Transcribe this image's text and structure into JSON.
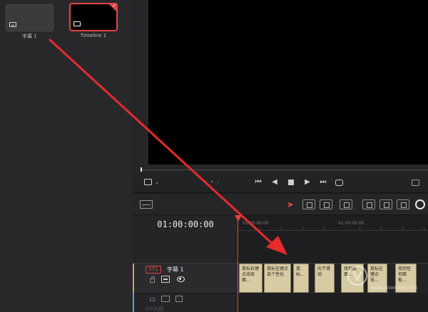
{
  "media_pool": {
    "clips": [
      {
        "label": "字幕 1"
      },
      {
        "label": "Timeline 1"
      }
    ]
  },
  "transport": {
    "jog_dots": "• •  ›"
  },
  "timeline": {
    "timecode": "01:00:00:00",
    "ruler": [
      "01:00:00:00",
      "01:00:05:00"
    ],
    "track": {
      "id": "ST1",
      "name": "字幕 1"
    },
    "track2_name": "0个片段",
    "subtitle_clips": [
      "鼠标右键点击底面…",
      "鼠标左键点击个性化",
      "鼠标…",
      "向下滑动",
      "找到底面…",
      "鼠标左键点击…",
      "找到任何面板…"
    ]
  },
  "watermark": {
    "text": "www.downxia.com"
  },
  "colors": {
    "accent_red": "#e04543",
    "subtitle_clip": "#d7cba4",
    "track_accent": "#b9a778"
  }
}
